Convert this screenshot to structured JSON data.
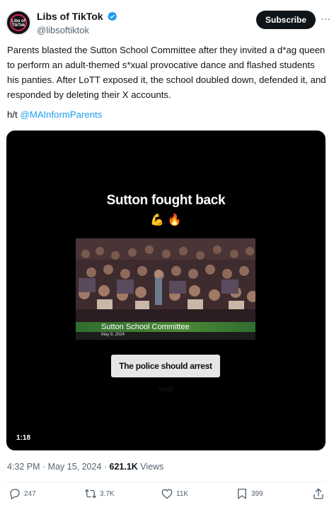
{
  "author": {
    "display_name": "Libs of TikTok",
    "handle": "@libsoftiktok",
    "avatar_text": "Libs of TikTok",
    "verified": true
  },
  "header": {
    "subscribe_label": "Subscribe",
    "more_label": "···"
  },
  "tweet": {
    "text": "Parents blasted the Sutton School Committee after they invited a d*ag queen to perform an adult-themed s*xual provocative dance and flashed students his panties. After LoTT exposed it, the school doubled down, defended it, and responded by deleting their X accounts.",
    "ht_prefix": "h/t ",
    "mention": "@MAInformParents"
  },
  "media": {
    "overlay_title": "Sutton fought back",
    "emoji_muscle": "💪",
    "emoji_fire": "🔥",
    "lower_third_title": "Sutton School Committee",
    "lower_third_date": "May 9, 2024",
    "caption": "The police should arrest you",
    "duration": "1:18"
  },
  "meta": {
    "time_date": "4:32 PM · May 15, 2024 · ",
    "views_count": "621.1K",
    "views_label": " Views"
  },
  "actions": {
    "replies": "247",
    "reposts": "3.7K",
    "likes": "11K",
    "bookmarks": "399"
  },
  "colors": {
    "accent": "#1d9bf0",
    "text": "#0f1419",
    "secondary": "#536471",
    "subscribe_bg": "#0f1419"
  }
}
